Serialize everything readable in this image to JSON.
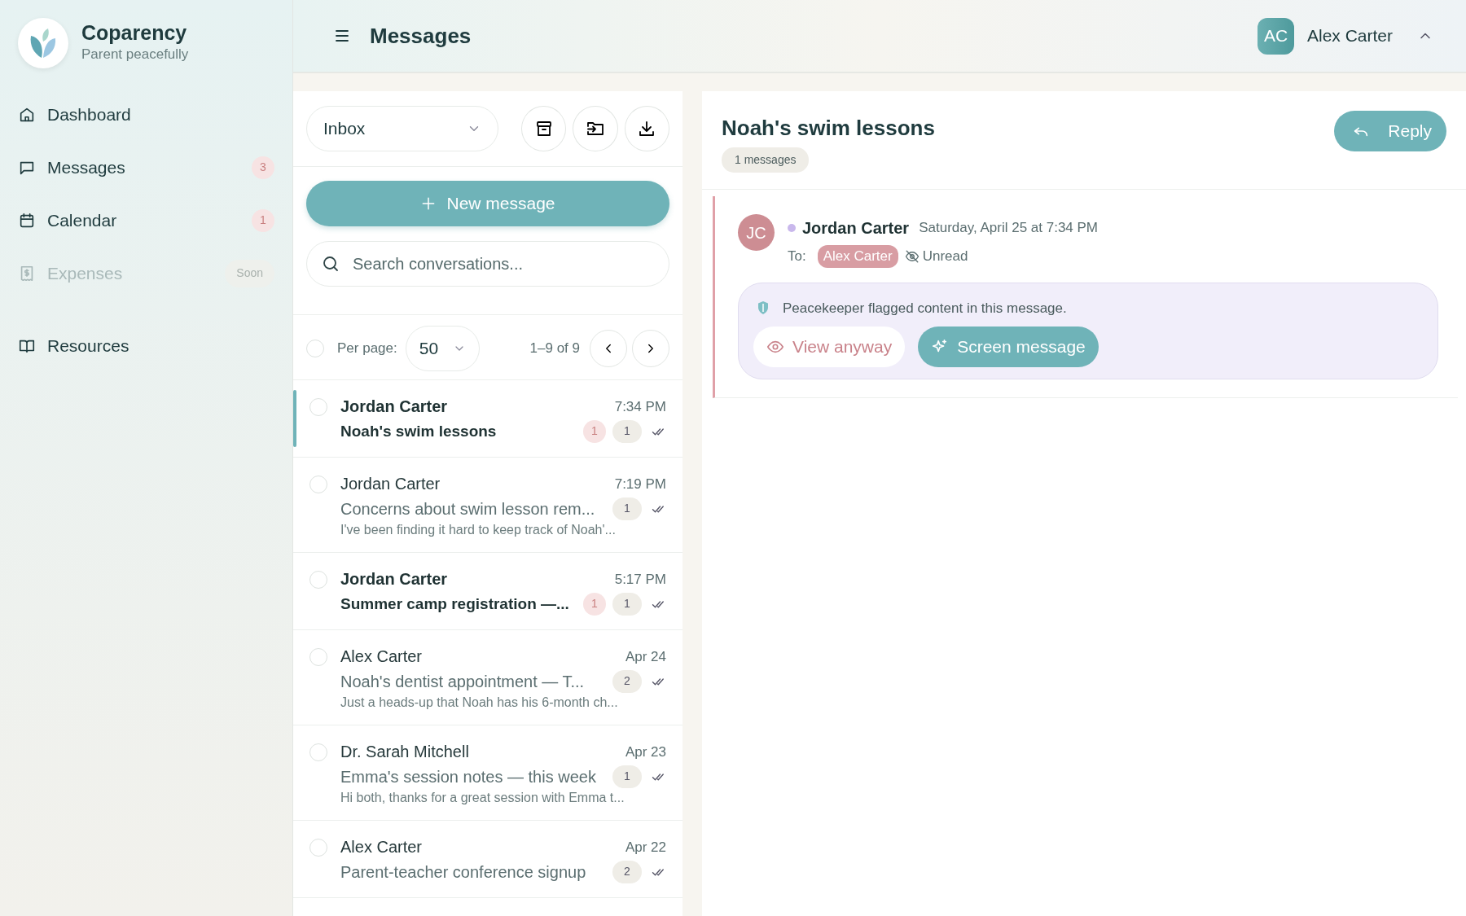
{
  "brand": {
    "name": "Coparency",
    "tagline": "Parent peacefully"
  },
  "nav": [
    {
      "label": "Dashboard",
      "disabled": false
    },
    {
      "label": "Messages",
      "badge": "3",
      "disabled": false
    },
    {
      "label": "Calendar",
      "badge": "1",
      "disabled": false
    },
    {
      "label": "Expenses",
      "badge": "Soon",
      "disabled": true
    }
  ],
  "nav_secondary": [
    {
      "label": "Resources"
    }
  ],
  "header": {
    "title": "Messages",
    "user": {
      "initials": "AC",
      "name": "Alex Carter"
    }
  },
  "list": {
    "folder": "Inbox",
    "new_message": "New message",
    "search": {
      "placeholder": "Search conversations..."
    },
    "select_all": {
      "checked": false
    },
    "per_page_label": "Per page:",
    "per_page": "50",
    "range": "1–9 of 9",
    "conversations": [
      {
        "sender": "Jordan Carter",
        "time": "7:34 PM",
        "subject": "Noah's swim lessons",
        "unread": true,
        "flags": "1",
        "count": "1",
        "selected": true,
        "checked": false
      },
      {
        "sender": "Jordan Carter",
        "time": "7:19 PM",
        "subject": "Concerns about swim lesson rem...",
        "preview": "I've been finding it hard to keep track of Noah'...",
        "unread": false,
        "count": "1",
        "selected": false,
        "checked": false
      },
      {
        "sender": "Jordan Carter",
        "time": "5:17 PM",
        "subject": "Summer camp registration —...",
        "unread": true,
        "flags": "1",
        "count": "1",
        "selected": false,
        "checked": false
      },
      {
        "sender": "Alex Carter",
        "time": "Apr 24",
        "subject": "Noah's dentist appointment — T...",
        "preview": "Just a heads-up that Noah has his 6-month ch...",
        "unread": false,
        "count": "2",
        "selected": false,
        "checked": false
      },
      {
        "sender": "Dr. Sarah Mitchell",
        "time": "Apr 23",
        "subject": "Emma's session notes — this week",
        "preview": "Hi both, thanks for a great session with Emma t...",
        "unread": false,
        "count": "1",
        "selected": false,
        "checked": false
      },
      {
        "sender": "Alex Carter",
        "time": "Apr 22",
        "subject": "Parent-teacher conference signup",
        "unread": false,
        "count": "2",
        "selected": false,
        "checked": false
      }
    ]
  },
  "reader": {
    "title": "Noah's swim lessons",
    "count": "1 messages",
    "reply": "Reply",
    "message": {
      "initials": "JC",
      "sender": "Jordan Carter",
      "color": "#c9b8ec",
      "date": "Saturday, April 25 at 7:34 PM",
      "to_label": "To:",
      "recipient": "Alex Carter",
      "status": "Unread",
      "flagged": true,
      "flag": {
        "text": "Peacekeeper flagged content in this message.",
        "view": "View anyway",
        "screen": "Screen message"
      }
    }
  }
}
